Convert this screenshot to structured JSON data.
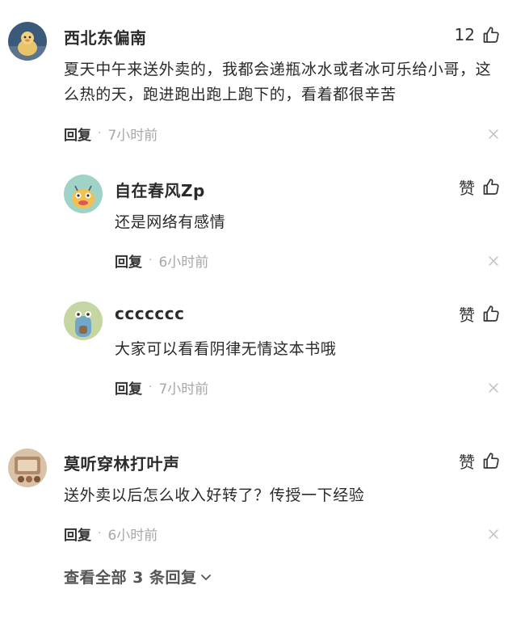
{
  "comments": [
    {
      "username": "西北东偏南",
      "like_label": "12",
      "content": "夏天中午来送外卖的，我都会递瓶冰水或者冰可乐给小哥，这么热的天，跑进跑出跑上跑下的，看着都很辛苦",
      "reply_label": "回复",
      "separator": "·",
      "time": "7小时前",
      "replies": [
        {
          "username": "自在春风Zp",
          "like_label": "赞",
          "content": "还是网络有感情",
          "reply_label": "回复",
          "separator": "·",
          "time": "6小时前"
        },
        {
          "username": "ccccccc",
          "like_label": "赞",
          "content": "大家可以看看阴律无情这本书哦",
          "reply_label": "回复",
          "separator": "·",
          "time": "7小时前"
        }
      ]
    },
    {
      "username": "莫听穿林打叶声",
      "like_label": "赞",
      "content": "送外卖以后怎么收入好转了？传授一下经验",
      "reply_label": "回复",
      "separator": "·",
      "time": "6小时前"
    }
  ],
  "view_all_label": "查看全部 3 条回复"
}
